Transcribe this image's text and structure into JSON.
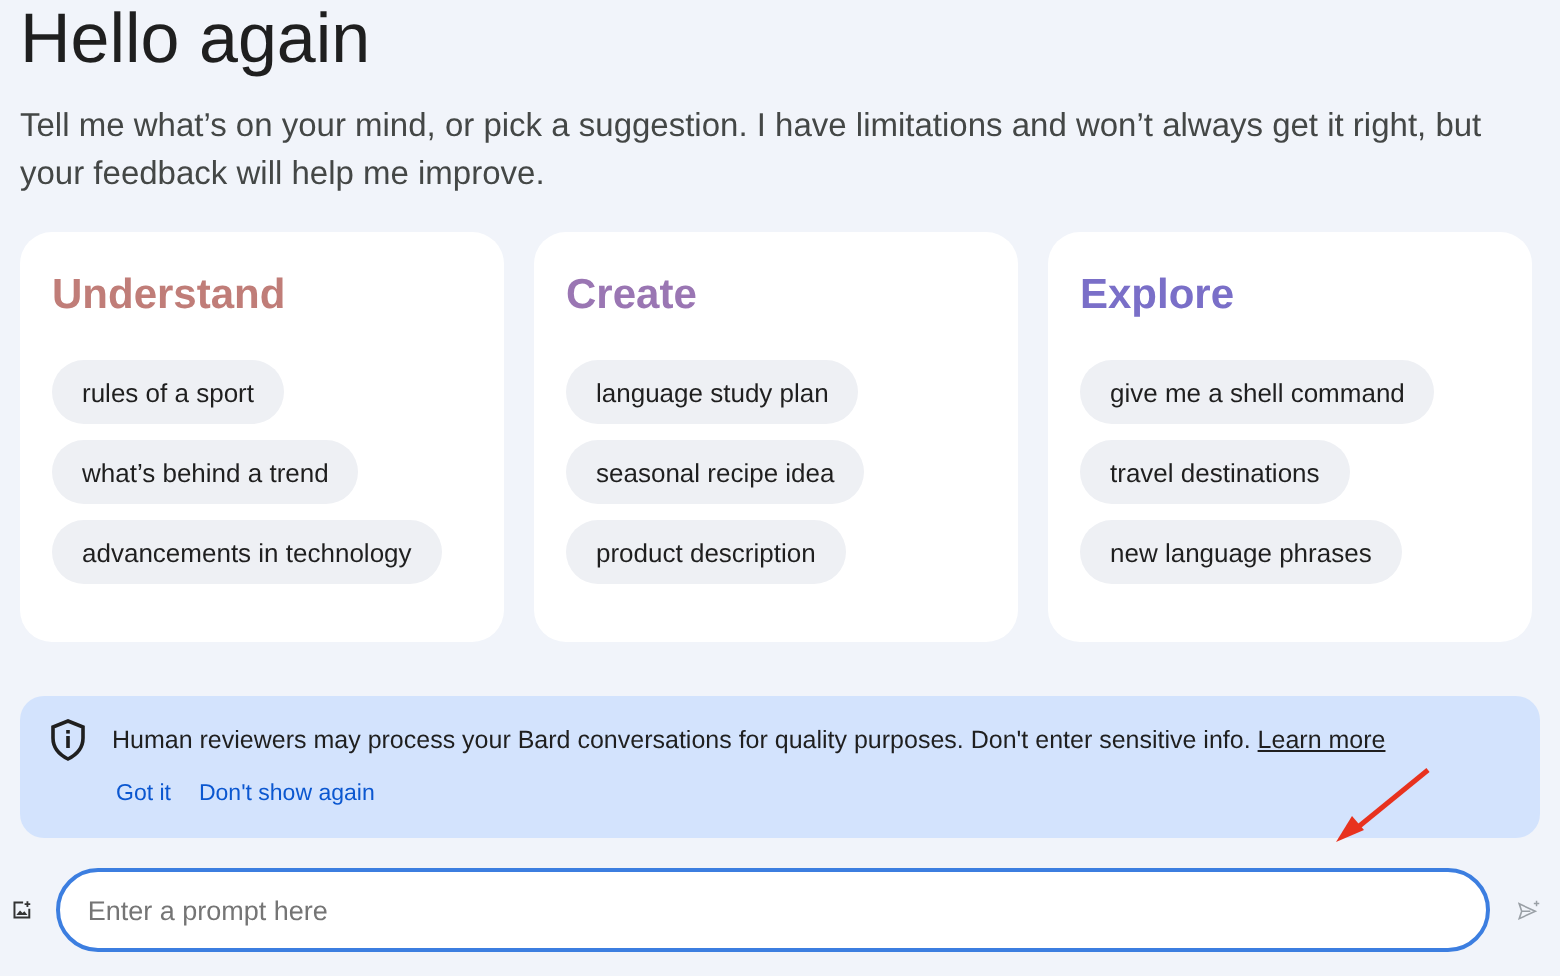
{
  "heading": "Hello again",
  "intro": "Tell me what’s on your mind, or pick a suggestion. I have limitations and won’t always get it right, but your feedback will help me improve.",
  "cards": [
    {
      "title": "Understand",
      "color": "#c07d78",
      "suggestions": [
        "rules of a sport",
        "what’s behind a trend",
        "advancements in technology"
      ]
    },
    {
      "title": "Create",
      "color": "#9a76b3",
      "suggestions": [
        "language study plan",
        "seasonal recipe idea",
        "product description"
      ]
    },
    {
      "title": "Explore",
      "color": "#7a6fc8",
      "suggestions": [
        "give me a shell command",
        "travel destinations",
        "new language phrases"
      ]
    }
  ],
  "notice": {
    "text": "Human reviewers may process your Bard conversations for quality purposes. Don't enter sensitive info.",
    "link": "Learn more",
    "actions": [
      "Got it",
      "Don't show again"
    ]
  },
  "prompt": {
    "placeholder": "Enter a prompt here"
  }
}
